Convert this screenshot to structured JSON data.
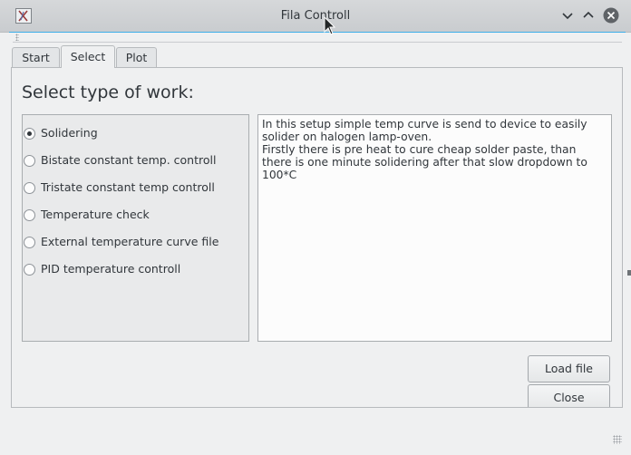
{
  "window": {
    "title": "Fila Controll",
    "icons": [
      "app-icon",
      "minimize-icon",
      "maximize-icon",
      "close-icon"
    ]
  },
  "tabs": [
    {
      "label": "Start",
      "active": false
    },
    {
      "label": "Select",
      "active": true
    },
    {
      "label": "Plot",
      "active": false
    }
  ],
  "main": {
    "heading": "Select type of work:",
    "options": [
      {
        "label": "Solidering",
        "checked": true
      },
      {
        "label": "Bistate constant temp. controll",
        "checked": false
      },
      {
        "label": "Tristate constant temp controll",
        "checked": false
      },
      {
        "label": "Temperature check",
        "checked": false
      },
      {
        "label": "External temperature curve file",
        "checked": false
      },
      {
        "label": "PID temperature controll",
        "checked": false
      }
    ],
    "description_lines": [
      "In this setup simple temp curve is send to device to easily solider on halogen lamp-oven.",
      "Firstly there is pre heat to cure cheap solder paste, than there is one minute solidering after that slow dropdown to 100*C"
    ],
    "buttons": {
      "load": "Load file",
      "close": "Close"
    }
  },
  "colors": {
    "accent": "#3daee9",
    "window_bg": "#eff0f1",
    "close_button": "#5f6367"
  }
}
